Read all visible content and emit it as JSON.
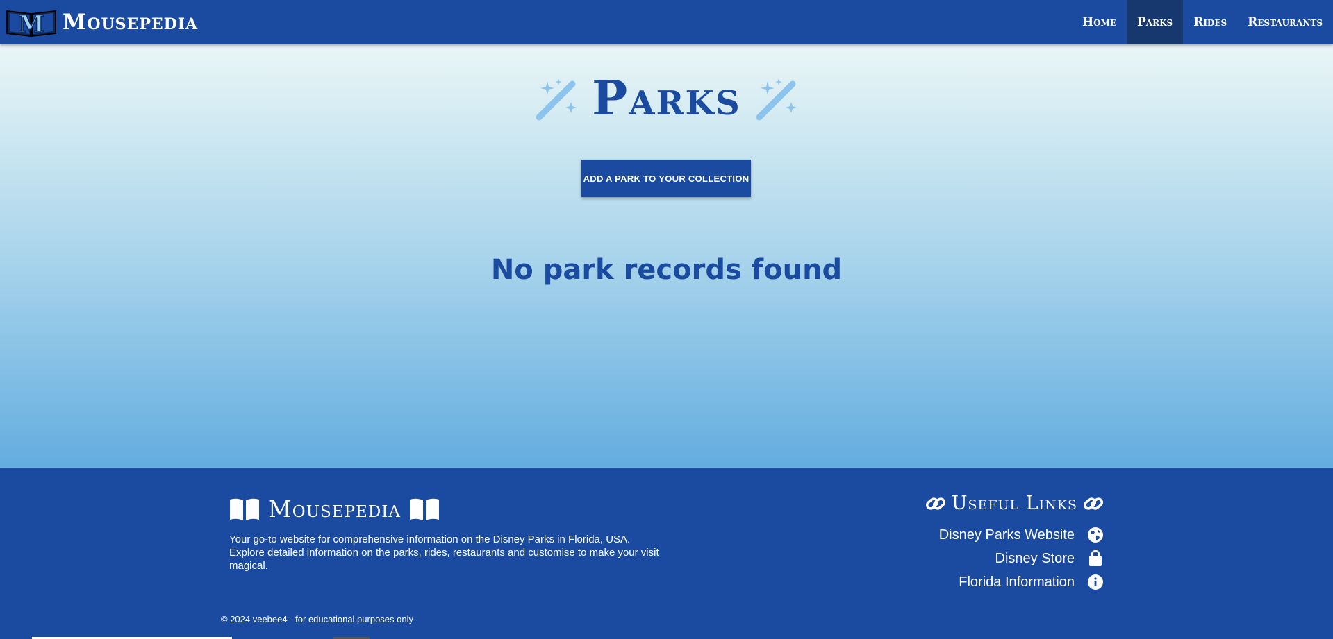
{
  "brand": {
    "name": "Mousepedia",
    "logo_icon": "mousepedia-book-logo-icon"
  },
  "nav": {
    "items": [
      {
        "label": "Home",
        "active": false
      },
      {
        "label": "Parks",
        "active": true
      },
      {
        "label": "Rides",
        "active": false
      },
      {
        "label": "Restaurants",
        "active": false
      }
    ]
  },
  "main": {
    "title": "Parks",
    "title_icon": "magic-wand-icon",
    "add_button_label": "ADD A PARK TO YOUR COLLECTION",
    "empty_message": "No park records found"
  },
  "footer": {
    "brand_name": "Mousepedia",
    "brand_icon": "open-book-icon",
    "description": "Your go-to website for comprehensive information on the Disney Parks in Florida, USA. Explore detailed information on the parks, rides, restaurants and customise to make your visit magical.",
    "links_title": "Useful Links",
    "links_title_icon": "link-icon",
    "links": [
      {
        "label": "Disney Parks Website",
        "icon": "globe-icon"
      },
      {
        "label": "Disney Store",
        "icon": "shopping-bag-icon"
      },
      {
        "label": "Florida Information",
        "icon": "info-circle-icon"
      }
    ],
    "copyright": "© 2024 veebee4 - for educational purposes only"
  },
  "colors": {
    "primary": "#1a4ba0",
    "nav_active": "#17386f",
    "wand_light": "#8cc4ee",
    "gradient_top": "#eaf6f6",
    "gradient_bottom": "#63addf"
  }
}
